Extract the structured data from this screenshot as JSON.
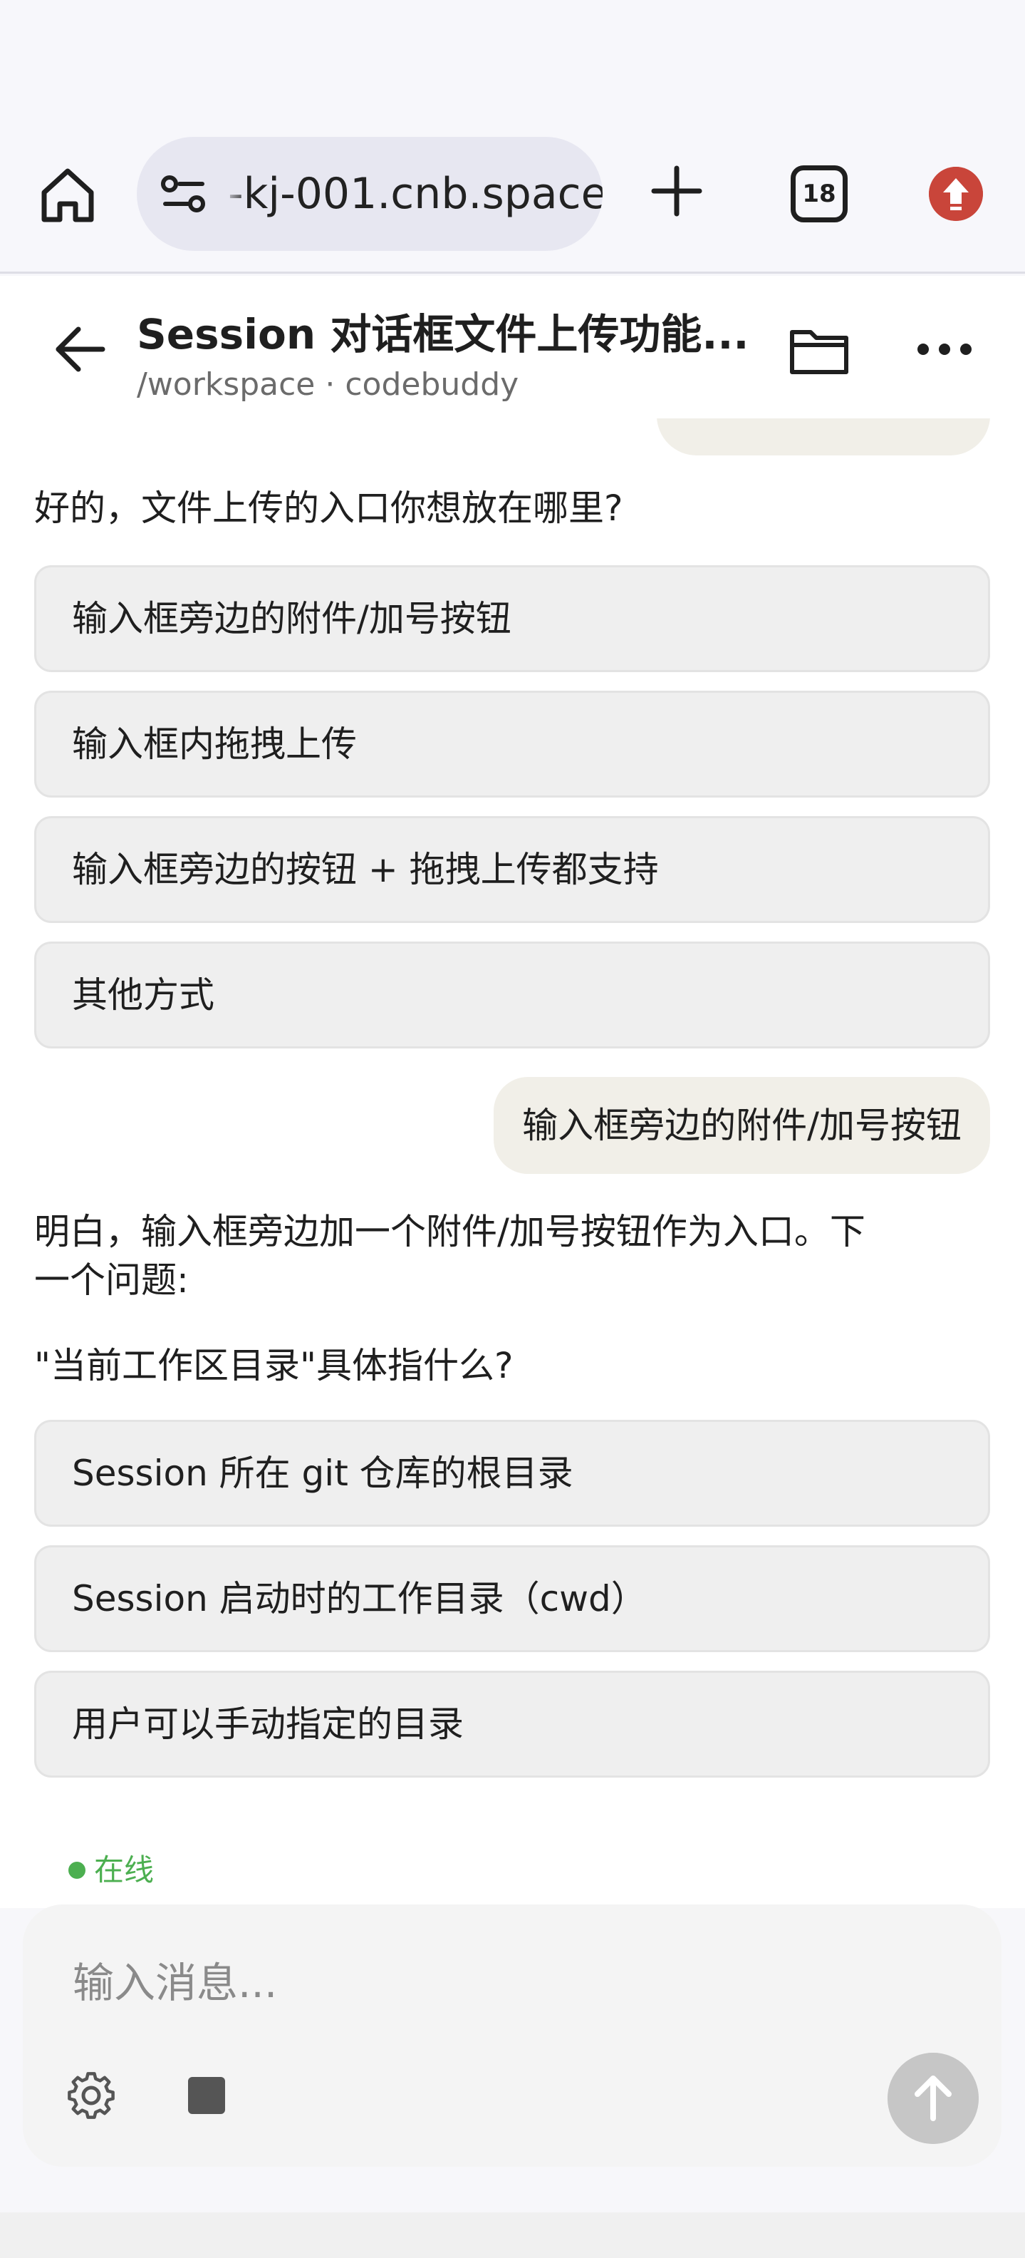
{
  "browser": {
    "url": "-kj-001.cnb.space",
    "tab_count": "18",
    "icons": [
      "home-icon",
      "site-settings-icon",
      "new-tab-icon",
      "tabs-icon",
      "update-icon"
    ]
  },
  "header": {
    "title": "Session 对话框文件上传功能...",
    "path": "/workspace · codebuddy",
    "icons": [
      "back-arrow-icon",
      "folder-icon",
      "more-icon"
    ]
  },
  "chat": {
    "q1": "好的，文件上传的入口你想放在哪里?",
    "options1": [
      "输入框旁边的附件/加号按钮",
      "输入框内拖拽上传",
      "输入框旁边的按钮 + 拖拽上传都支持",
      "其他方式"
    ],
    "user_reply": "输入框旁边的附件/加号按钮",
    "a2_line1": "明白，输入框旁边加一个附件/加号按钮作为入口。下",
    "a2_line2": "一个问题:",
    "q2": "\"当前工作区目录\"具体指什么?",
    "options2": [
      "Session 所在 git 仓库的根目录",
      "Session 启动时的工作目录（cwd）",
      "用户可以手动指定的目录"
    ]
  },
  "status": {
    "label": "在线",
    "color": "#4caf50"
  },
  "composer": {
    "placeholder": "输入消息...",
    "icons": [
      "settings-icon",
      "stop-icon",
      "send-arrow-icon"
    ]
  },
  "colors": {
    "accent_update": "#c9453a",
    "bubble_user": "#f1efe8",
    "option_bg": "#efefef"
  }
}
